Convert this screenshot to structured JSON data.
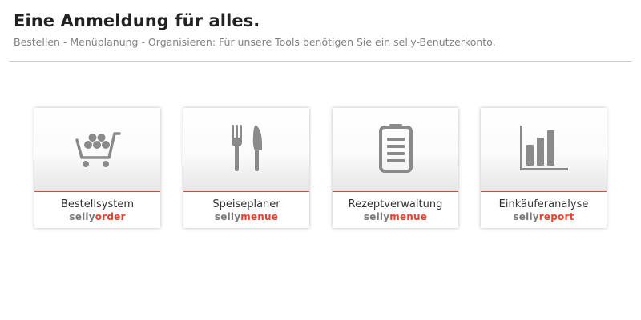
{
  "header": {
    "title": "Eine Anmeldung für alles.",
    "subtitle": "Bestellen - Menüplanung - Organisieren: Für unsere Tools benötigen Sie ein selly-Benutzerkonto."
  },
  "cards": [
    {
      "label": "Bestellsystem",
      "brand_prefix": "selly",
      "brand_suffix": "order",
      "icon": "shopping-cart-icon"
    },
    {
      "label": "Speiseplaner",
      "brand_prefix": "selly",
      "brand_suffix": "menue",
      "icon": "fork-knife-icon"
    },
    {
      "label": "Rezeptverwaltung",
      "brand_prefix": "selly",
      "brand_suffix": "menue",
      "icon": "clipboard-icon"
    },
    {
      "label": "Einkäuferanalyse",
      "brand_prefix": "selly",
      "brand_suffix": "report",
      "icon": "bar-chart-icon"
    }
  ],
  "colors": {
    "accent": "#e8412c",
    "icon": "#8a8a8a",
    "brand_gray": "#7a7a7a"
  }
}
